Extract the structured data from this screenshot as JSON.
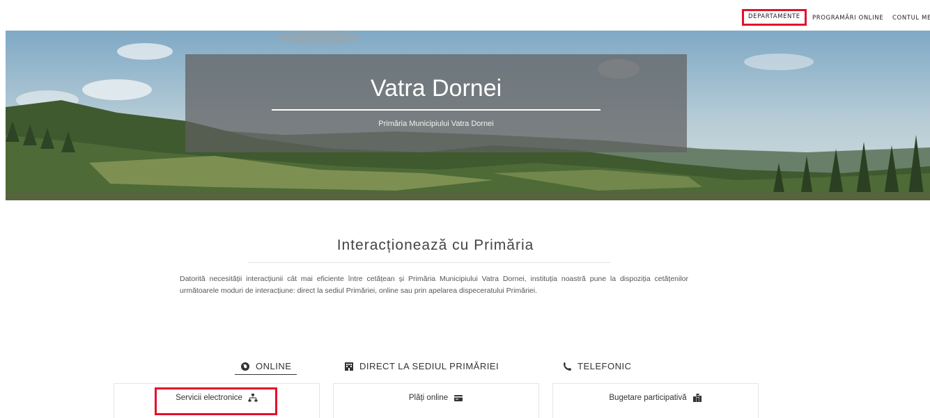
{
  "nav": {
    "items": [
      {
        "label": "DEPARTAMENTE",
        "highlighted": true
      },
      {
        "label": "PROGRAMĂRI ONLINE",
        "highlighted": false
      },
      {
        "label": "CONTUL MEU",
        "highlighted": false
      }
    ]
  },
  "hero": {
    "title": "Vatra Dornei",
    "subtitle": "Primăria Municipiului Vatra Dornei"
  },
  "section": {
    "title": "Interacționează cu Primăria",
    "text": "Datorită necesității interacțiunii cât mai eficiente între cetățean și Primăria Municipiului Vatra Dornei, instituția noastră pune la dispoziția cetățenilor următoarele moduri de interacțiune: direct la sediul Primăriei, online sau prin apelarea dispeceratului Primăriei."
  },
  "tabs": [
    {
      "label": "ONLINE",
      "icon": "globe-icon",
      "active": true
    },
    {
      "label": "DIRECT LA SEDIUL PRIMĂRIEI",
      "icon": "building-icon",
      "active": false
    },
    {
      "label": "TELEFONIC",
      "icon": "phone-icon",
      "active": false
    }
  ],
  "cards": [
    {
      "label": "Servicii electronice",
      "icon": "sitemap-icon",
      "highlighted": true
    },
    {
      "label": "Plăți online",
      "icon": "credit-card-icon",
      "highlighted": false
    },
    {
      "label": "Bugetare participativă",
      "icon": "building-group-icon",
      "highlighted": false
    }
  ],
  "colors": {
    "highlight": "#e3102a",
    "text": "#333333",
    "panel": "rgba(95,95,95,0.72)"
  }
}
